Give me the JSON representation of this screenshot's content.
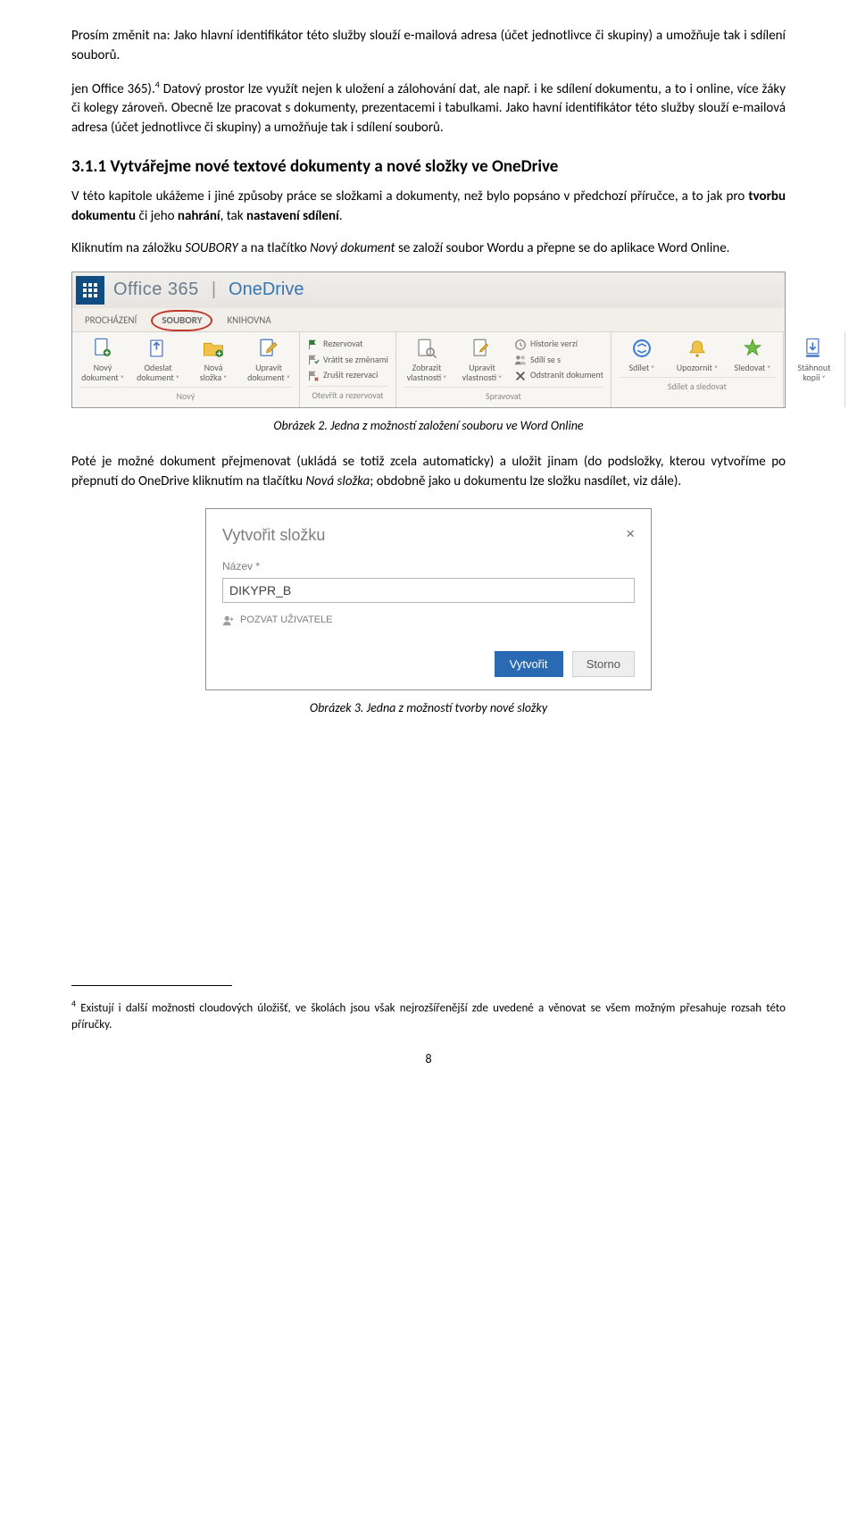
{
  "note_para": "Prosím změnit na: Jako hlavní identifikátor této služby slouží e-mailová adresa (účet jednotlivce či skupiny) a umožňuje tak i sdílení souborů.",
  "para2_a": "jen Office 365).",
  "para2_sup": "4",
  "para2_b": " Datový prostor lze využít nejen k uložení a zálohování dat, ale např. i ke sdílení dokumentu, a to i online, více žáky či kolegy zároveň. Obecně lze pracovat s dokumenty, prezentacemi i tabulkami. Jako havní identifikátor této služby slouží e-mailová adresa (účet jednotlivce či skupiny) a umožňuje tak i sdílení souborů.",
  "heading": "3.1.1   Vytvářejme nové textové dokumenty a nové složky ve OneDrive",
  "para3_a": "V této kapitole ukážeme i jiné způsoby práce se složkami a dokumenty, než bylo popsáno v předchozí příručce, a to jak pro ",
  "para3_b1": "tvorbu dokumentu",
  "para3_c": " či jeho ",
  "para3_b2": "nahrání",
  "para3_d": ", tak ",
  "para3_b3": "nastavení sdílení",
  "para3_e": ".",
  "para4_a": "Kliknutím na záložku ",
  "para4_i1": "SOUBORY",
  "para4_b": " a na tlačítko ",
  "para4_i2": "Nový dokument",
  "para4_c": " se založí soubor Wordu a přepne se do aplikace Word Online.",
  "caption2": "Obrázek 2.   Jedna z možností založení souboru ve Word Online",
  "para5_a": "Poté je možné dokument přejmenovat (ukládá se totiž zcela automaticky) a uložit jinam (do podsložky, kterou vytvoříme po přepnutí do OneDrive kliknutím na tlačítku ",
  "para5_i1": "Nová složka",
  "para5_b": "; obdobně jako u dokumentu lze složku nasdílet, viz dále).",
  "caption3": "Obrázek 3.   Jedna z možností tvorby nové složky",
  "footnote_num": "4",
  "footnote_text": " Existují i další možnosti cloudových úložišť, ve školách jsou však nejrozšířenější zde uvedené a věnovat se všem možným přesahuje rozsah této příručky.",
  "pagenum": "8",
  "ribbon": {
    "brand_o365": "Office 365",
    "brand_od": "OneDrive",
    "tabs": [
      "PROCHÁZENÍ",
      "SOUBORY",
      "KNIHOVNA"
    ],
    "groups": [
      {
        "label": "Nový",
        "big": [
          {
            "name": "novy-dokument",
            "t1": "Nový",
            "t2": "dokument",
            "icon": "doc-new"
          },
          {
            "name": "odeslat-dokument",
            "t1": "Odeslat",
            "t2": "dokument",
            "icon": "doc-up"
          },
          {
            "name": "nova-slozka",
            "t1": "Nová",
            "t2": "složka",
            "icon": "folder-new"
          },
          {
            "name": "upravit-dokument",
            "t1": "Upravit",
            "t2": "dokument",
            "icon": "doc-edit"
          }
        ],
        "small": []
      },
      {
        "label": "Otevřít a rezervovat",
        "big": [],
        "small": [
          {
            "name": "rezervovat",
            "label": "Rezervovat",
            "icon": "flag-green"
          },
          {
            "name": "vratit-se-zmenami",
            "label": "Vrátit se změnami",
            "icon": "flag-check"
          },
          {
            "name": "zrusit-rezervaci",
            "label": "Zrušit rezervaci",
            "icon": "flag-x"
          }
        ]
      },
      {
        "label": "Spravovat",
        "big": [
          {
            "name": "zobrazit-vlastnosti",
            "t1": "Zobrazit",
            "t2": "vlastnosti",
            "icon": "view"
          },
          {
            "name": "upravit-vlastnosti",
            "t1": "Upravit",
            "t2": "vlastnosti",
            "icon": "edit-prop"
          }
        ],
        "small": [
          {
            "name": "historie-verzi",
            "label": "Historie verzí",
            "icon": "history"
          },
          {
            "name": "sdili-se-s",
            "label": "Sdílí se s",
            "icon": "people"
          },
          {
            "name": "odstranit-dokument",
            "label": "Odstranit dokument",
            "icon": "delete"
          }
        ]
      },
      {
        "label": "Sdílet a sledovat",
        "big": [
          {
            "name": "sdilet",
            "t1": "Sdílet",
            "t2": "",
            "icon": "share"
          },
          {
            "name": "upozornit",
            "t1": "Upozornit",
            "t2": "",
            "icon": "alert"
          },
          {
            "name": "sledovat",
            "t1": "Sledovat",
            "t2": "",
            "icon": "follow"
          }
        ],
        "small": []
      },
      {
        "label": "",
        "big": [
          {
            "name": "stahnout-kopii",
            "t1": "Stáhnout",
            "t2": "kopii",
            "icon": "download"
          }
        ],
        "small": []
      }
    ]
  },
  "dialog": {
    "title": "Vytvořit složku",
    "name_label": "Název *",
    "name_value": "DIKYPR_B",
    "invite": "POZVAT UŽIVATELE",
    "create": "Vytvořit",
    "cancel": "Storno"
  }
}
